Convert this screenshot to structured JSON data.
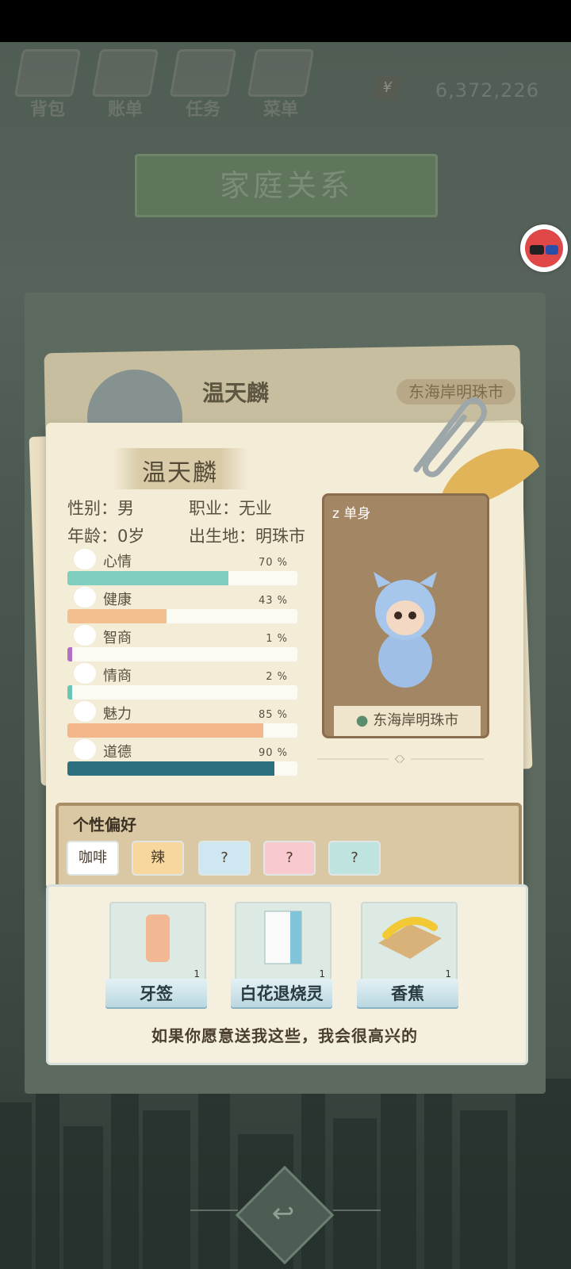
{
  "nav": {
    "items": [
      {
        "label": "背包",
        "icon": "bag-icon"
      },
      {
        "label": "账单",
        "icon": "bill-icon"
      },
      {
        "label": "任务",
        "icon": "task-icon"
      },
      {
        "label": "菜单",
        "icon": "menu-icon"
      }
    ],
    "money": "6,372,226",
    "money_symbol": "¥"
  },
  "title": "家庭关系",
  "underlay": {
    "name": "温天麟",
    "location": "东海岸明珠市"
  },
  "profile": {
    "name": "温天麟",
    "gender_label": "性别：男",
    "job_label": "职业：无业",
    "age_label": "年龄：0岁",
    "birthplace_label": "出生地：明珠市",
    "status": "单身",
    "location": "东海岸明珠市"
  },
  "stats": [
    {
      "label": "心情",
      "pct_text": "70 %",
      "value": 70,
      "color": "#7ecfc0",
      "icon": "smile-icon"
    },
    {
      "label": "健康",
      "pct_text": "43 %",
      "value": 43,
      "color": "#f3bf8e",
      "icon": "heart-icon"
    },
    {
      "label": "智商",
      "pct_text": "1 %",
      "value": 1,
      "color": "#b36fc2",
      "icon": "bulb-icon"
    },
    {
      "label": "情商",
      "pct_text": "2 %",
      "value": 2,
      "color": "#6ac6b8",
      "icon": "apple-icon"
    },
    {
      "label": "魅力",
      "pct_text": "85 %",
      "value": 85,
      "color": "#f2b68a",
      "icon": "star-icon"
    },
    {
      "label": "道德",
      "pct_text": "90 %",
      "value": 90,
      "color": "#2c6f7f",
      "icon": "scale-icon"
    }
  ],
  "preferences": {
    "title": "个性偏好",
    "items": [
      {
        "label": "咖啡",
        "bg": "#ffffff"
      },
      {
        "label": "辣",
        "bg": "#f7d79c"
      },
      {
        "label": "?",
        "bg": "#cfe7f0"
      },
      {
        "label": "?",
        "bg": "#f8c9cf"
      },
      {
        "label": "?",
        "bg": "#bfe4e0"
      }
    ]
  },
  "gifts": [
    {
      "label": "牙签",
      "count": "1",
      "icon": "toothpick-icon"
    },
    {
      "label": "白花退烧灵",
      "count": "1",
      "icon": "medicine-box-icon"
    },
    {
      "label": "香蕉",
      "count": "1",
      "icon": "banana-icon"
    }
  ],
  "gift_message": "如果你愿意送我这些，我会很高兴的"
}
